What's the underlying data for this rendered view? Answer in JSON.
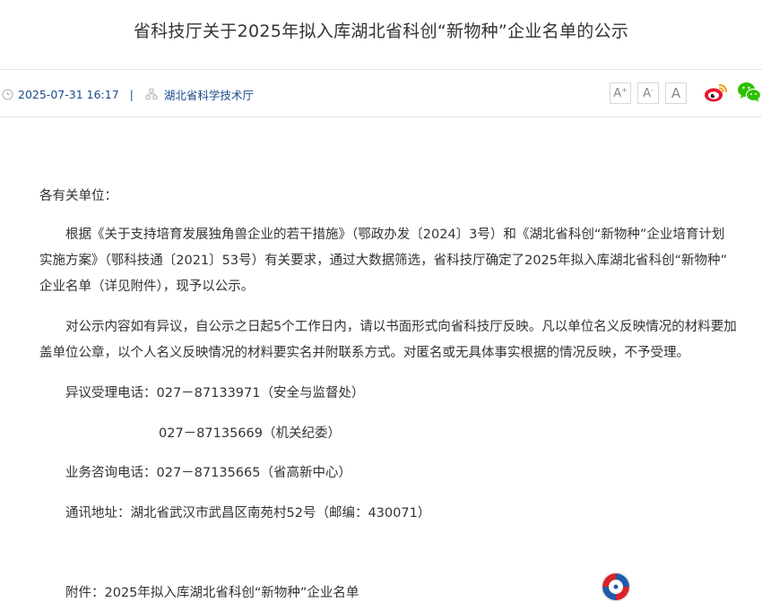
{
  "title": "省科技厅关于2025年拟入库湖北省科创“新物种”企业名单的公示",
  "meta": {
    "date": "2025-07-31 16:17",
    "separator": "|",
    "source": "湖北省科学技术厅"
  },
  "font_size_buttons": [
    "A",
    "A",
    "A"
  ],
  "font_size_marks": [
    "+",
    "-"
  ],
  "share_icons": [
    "weibo-icon",
    "wechat-icon"
  ],
  "body": {
    "salutation": "各有关单位：",
    "paragraph1_lines": [
      "根据《关于支持培育发展独角兽企业的若干措施》（鄂政办发〔2024〕3号）和《湖北省科创“新物种”企业培育计划",
      "实施方案》（鄂科技通〔2021〕53号）有关要求，通过大数据筛选，省科技厅确定了2025年拟入库湖北省科创“新物种”",
      "企业名单（详见附件），现予以公示。"
    ],
    "paragraph2_lines": [
      "对公示内容如有异议，自公示之日起5个工作日内，请以书面形式向省科技厅反映。凡以单位名义反映情况的材料要加",
      "盖单位公章，以个人名义反映情况的材料要实名并附联系方式。对匿名或无具体事实根据的情况反映，不予受理。"
    ],
    "objection_phone": "异议受理电话：027－87133971（安全与监督处）",
    "objection_phone2": "027－87135669（机关纪委）",
    "consult_phone": "业务咨询电话：027－87135665（省高新中心）",
    "address": "通讯地址：湖北省武汉市武昌区南苑村52号（邮编：430071）",
    "attachment": "附件：2025年拟入库湖北省科创“新物种”企业名单"
  },
  "colors": {
    "meta_text": "#1a4b8c",
    "weibo_red": "#e6162d",
    "weibo_orange": "#f4a11a",
    "wechat_green": "#2dc100"
  }
}
